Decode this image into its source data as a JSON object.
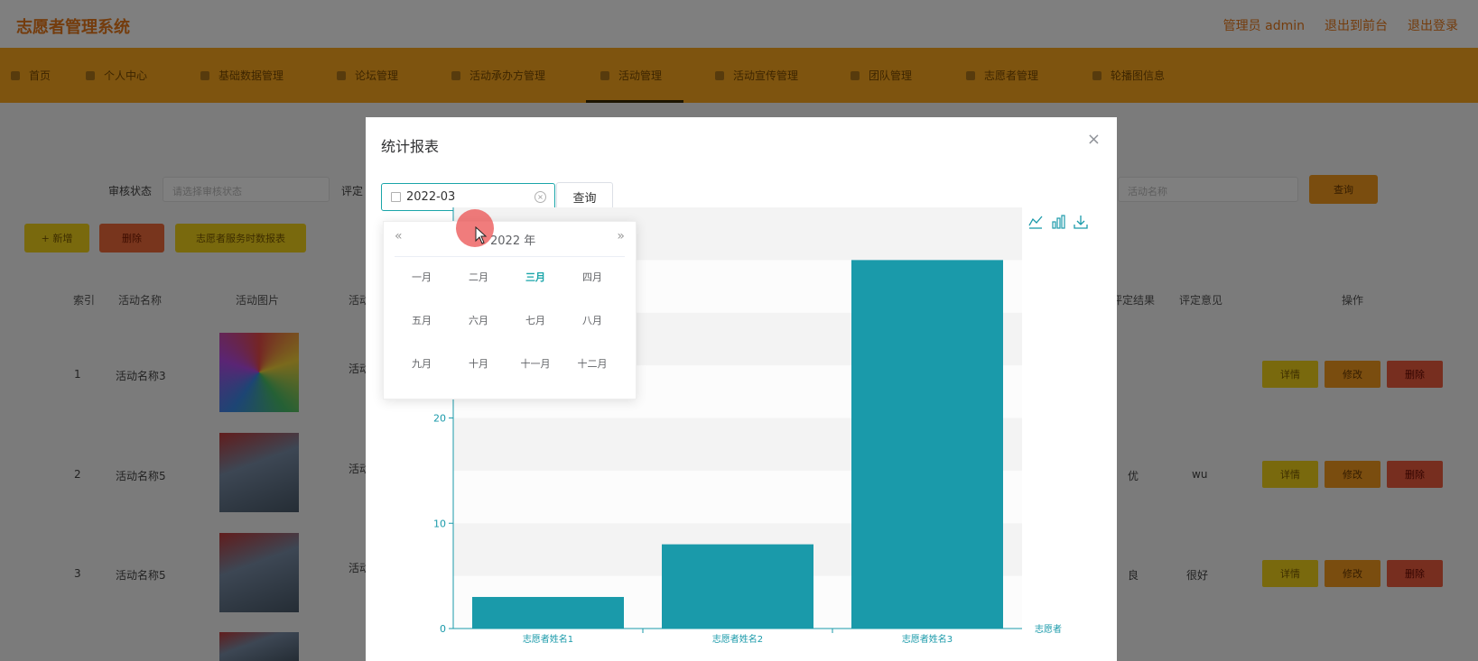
{
  "header": {
    "app_title": "志愿者管理系统",
    "links": [
      "管理员 admin",
      "退出到前台",
      "退出登录"
    ]
  },
  "nav": {
    "items": [
      "首页",
      "个人中心",
      "基础数据管理",
      "论坛管理",
      "活动承办方管理",
      "活动管理",
      "活动宣传管理",
      "团队管理",
      "志愿者管理",
      "轮播图信息"
    ],
    "active_index": 5
  },
  "page": {
    "filters": {
      "audit_label": "审核状态",
      "audit_placeholder": "请选择审核状态",
      "eval_label": "评定",
      "search_placeholder": "活动名称",
      "search_button": "查询"
    },
    "actions": {
      "add": "+ 新增",
      "delete": "删除",
      "report": "志愿者服务时数报表"
    },
    "table": {
      "headers": [
        "索引",
        "活动名称",
        "活动图片",
        "活动",
        "评定结果",
        "评定意见",
        "操作"
      ],
      "rows": [
        {
          "index": "1",
          "name": "活动名称3",
          "type": "活动",
          "result": "",
          "opinion": ""
        },
        {
          "index": "2",
          "name": "活动名称5",
          "type": "活动",
          "result": "优",
          "opinion": "wu"
        },
        {
          "index": "3",
          "name": "活动名称5",
          "type": "活动",
          "result": "良",
          "opinion": "很好"
        }
      ],
      "op_labels": {
        "detail": "详情",
        "edit": "修改",
        "delete": "删除"
      }
    }
  },
  "modal": {
    "title": "统计报表",
    "close_glyph": "×",
    "date_value": "2022-03",
    "query_label": "查询",
    "toolbox_icons": [
      "line-chart-icon",
      "bar-chart-icon",
      "download-icon"
    ]
  },
  "picker": {
    "year_label": "2022 年",
    "prev_glyph": "«",
    "next_glyph": "»",
    "months": [
      "一月",
      "二月",
      "三月",
      "四月",
      "五月",
      "六月",
      "七月",
      "八月",
      "九月",
      "十月",
      "十一月",
      "十二月"
    ],
    "current_index": 2
  },
  "chart_data": {
    "type": "bar",
    "categories": [
      "志愿者姓名1",
      "志愿者姓名2",
      "志愿者姓名3"
    ],
    "values": [
      3,
      8,
      35
    ],
    "xlabel": "志愿者",
    "yticks": [
      0,
      10,
      20
    ],
    "ylim": [
      0,
      40
    ],
    "color": "#1a9aaa",
    "grid": "alternating horizontal bands"
  }
}
